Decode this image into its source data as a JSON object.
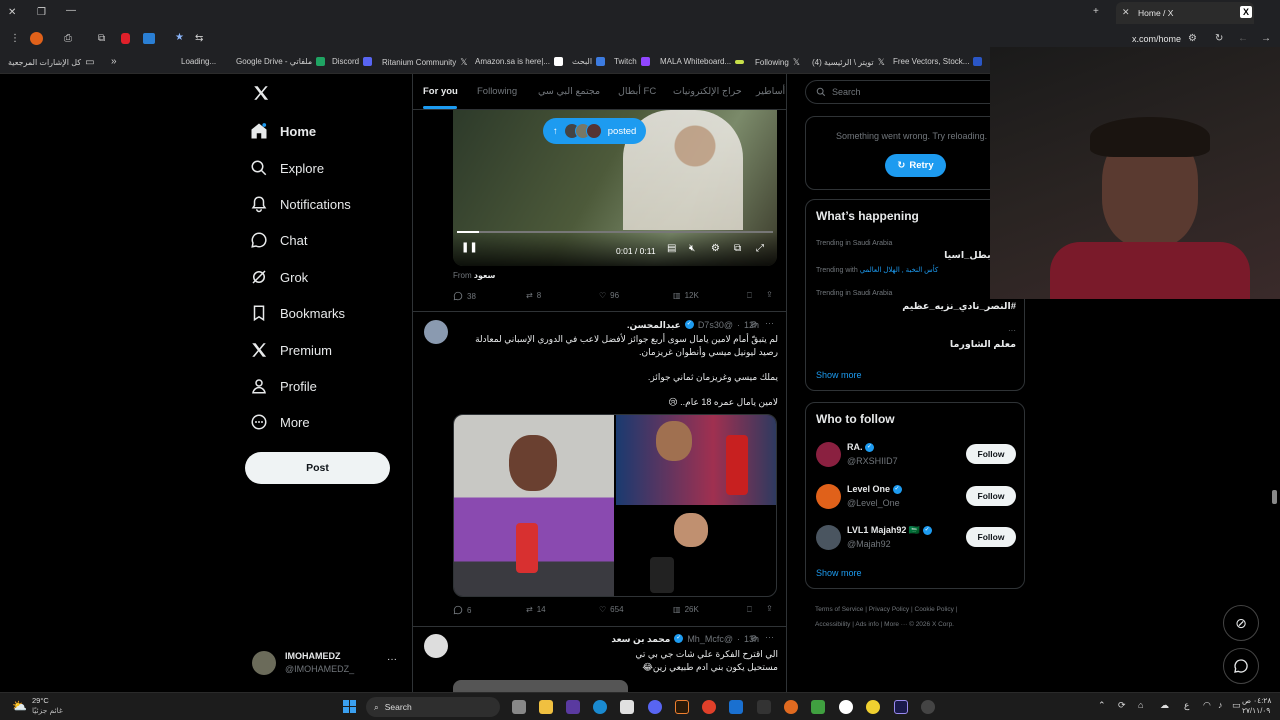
{
  "browser": {
    "tab_title": "Home / X",
    "url": "x.com/home",
    "bookmarks": [
      "كل الإشارات المرجعية",
      "Loading...",
      "Google Drive - ملفاتي",
      "Discord",
      "Ritanium Community",
      "Amazon.sa is here|...",
      "البحث",
      "Twitch",
      "MALA Whiteboard...",
      "Following",
      "تويتر \\ الرئيسية (4)",
      "Free Vectors, Stock..."
    ]
  },
  "nav": {
    "home": "Home",
    "explore": "Explore",
    "notifications": "Notifications",
    "chat": "Chat",
    "grok": "Grok",
    "bookmarks": "Bookmarks",
    "premium": "Premium",
    "profile": "Profile",
    "more": "More",
    "post": "Post"
  },
  "account": {
    "name": "IMOHAMEDZ",
    "handle": "@IMOHAMEDZ_"
  },
  "feed_tabs": [
    "For you",
    "Following",
    "مجتمع البي سي",
    "أبطال FC",
    "حراج الإلكترونيات",
    "أساطير"
  ],
  "video_post": {
    "posted_label": "posted",
    "time": "0:01 / 0:11",
    "from_label": "From",
    "from_name": "سعود",
    "replies": "38",
    "reposts": "8",
    "likes": "96",
    "views": "12K"
  },
  "tweet1": {
    "name": "عبدالمحسن.",
    "handle": "@D7s30",
    "time": "12h",
    "line1": "لم يتبقّ أمام لامين يامال سوى أربع جوائز لأفضل لاعب في الدوري الإسباني لمعادلة",
    "line2": "رصيد ليونيل ميسي وأنطوان غريزمان.",
    "line3": "يملك ميسي وغريزمان ثماني جوائز.",
    "line4": "لامين يامال عمره 18 عام.. 😢",
    "replies": "6",
    "reposts": "14",
    "likes": "654",
    "views": "26K"
  },
  "tweet2": {
    "name": "محمد بن سعد",
    "handle": "@Mh_Mcfc",
    "time": "13h",
    "line1": "الي اقترح الفكرة علي شات جي بي تي",
    "line2": "مستحيل يكون بني ادم طبيعي زين😂"
  },
  "search_placeholder": "Search",
  "error": {
    "text": "Something went wrong. Try reloading.",
    "retry": "Retry"
  },
  "happening": {
    "title": "What’s happening",
    "items": [
      {
        "sub": "Trending in Saudi Arabia",
        "main": "على_بطل_اسيا"
      },
      {
        "sub": "Trending with",
        "main": "كأس النخبة , الهلال العالمي"
      },
      {
        "sub": "Trending in Saudi Arabia",
        "main": "#النصر_نادي_نزيه_عظيم"
      },
      {
        "sub": "Trending in Saudi Arabia",
        "main": "معلم الشاورما"
      }
    ],
    "show_more": "Show more"
  },
  "who_to_follow": {
    "title": "Who to follow",
    "users": [
      {
        "name": "RA.",
        "handle": "@RXSHIID7",
        "avatar_color": "#8a2040"
      },
      {
        "name": "Level One",
        "handle": "@Level_One",
        "avatar_color": "#e0611a"
      },
      {
        "name": "LVL1 Majah92 🇸🇦",
        "handle": "@Majah92",
        "avatar_color": "#4a5560"
      }
    ],
    "follow": "Follow",
    "show_more": "Show more"
  },
  "footer_links": [
    "Terms of Service",
    "Privacy Policy",
    "Cookie Policy",
    "Accessibility",
    "Ads info",
    "More ···",
    "© 2026 X Corp."
  ],
  "taskbar": {
    "temp": "29°C",
    "weather": "غائم جزئيًا",
    "search": "Search",
    "time": "٠٤:٢٨ ص",
    "date": "٢٧/١١/٠٩",
    "lang": "ع"
  }
}
